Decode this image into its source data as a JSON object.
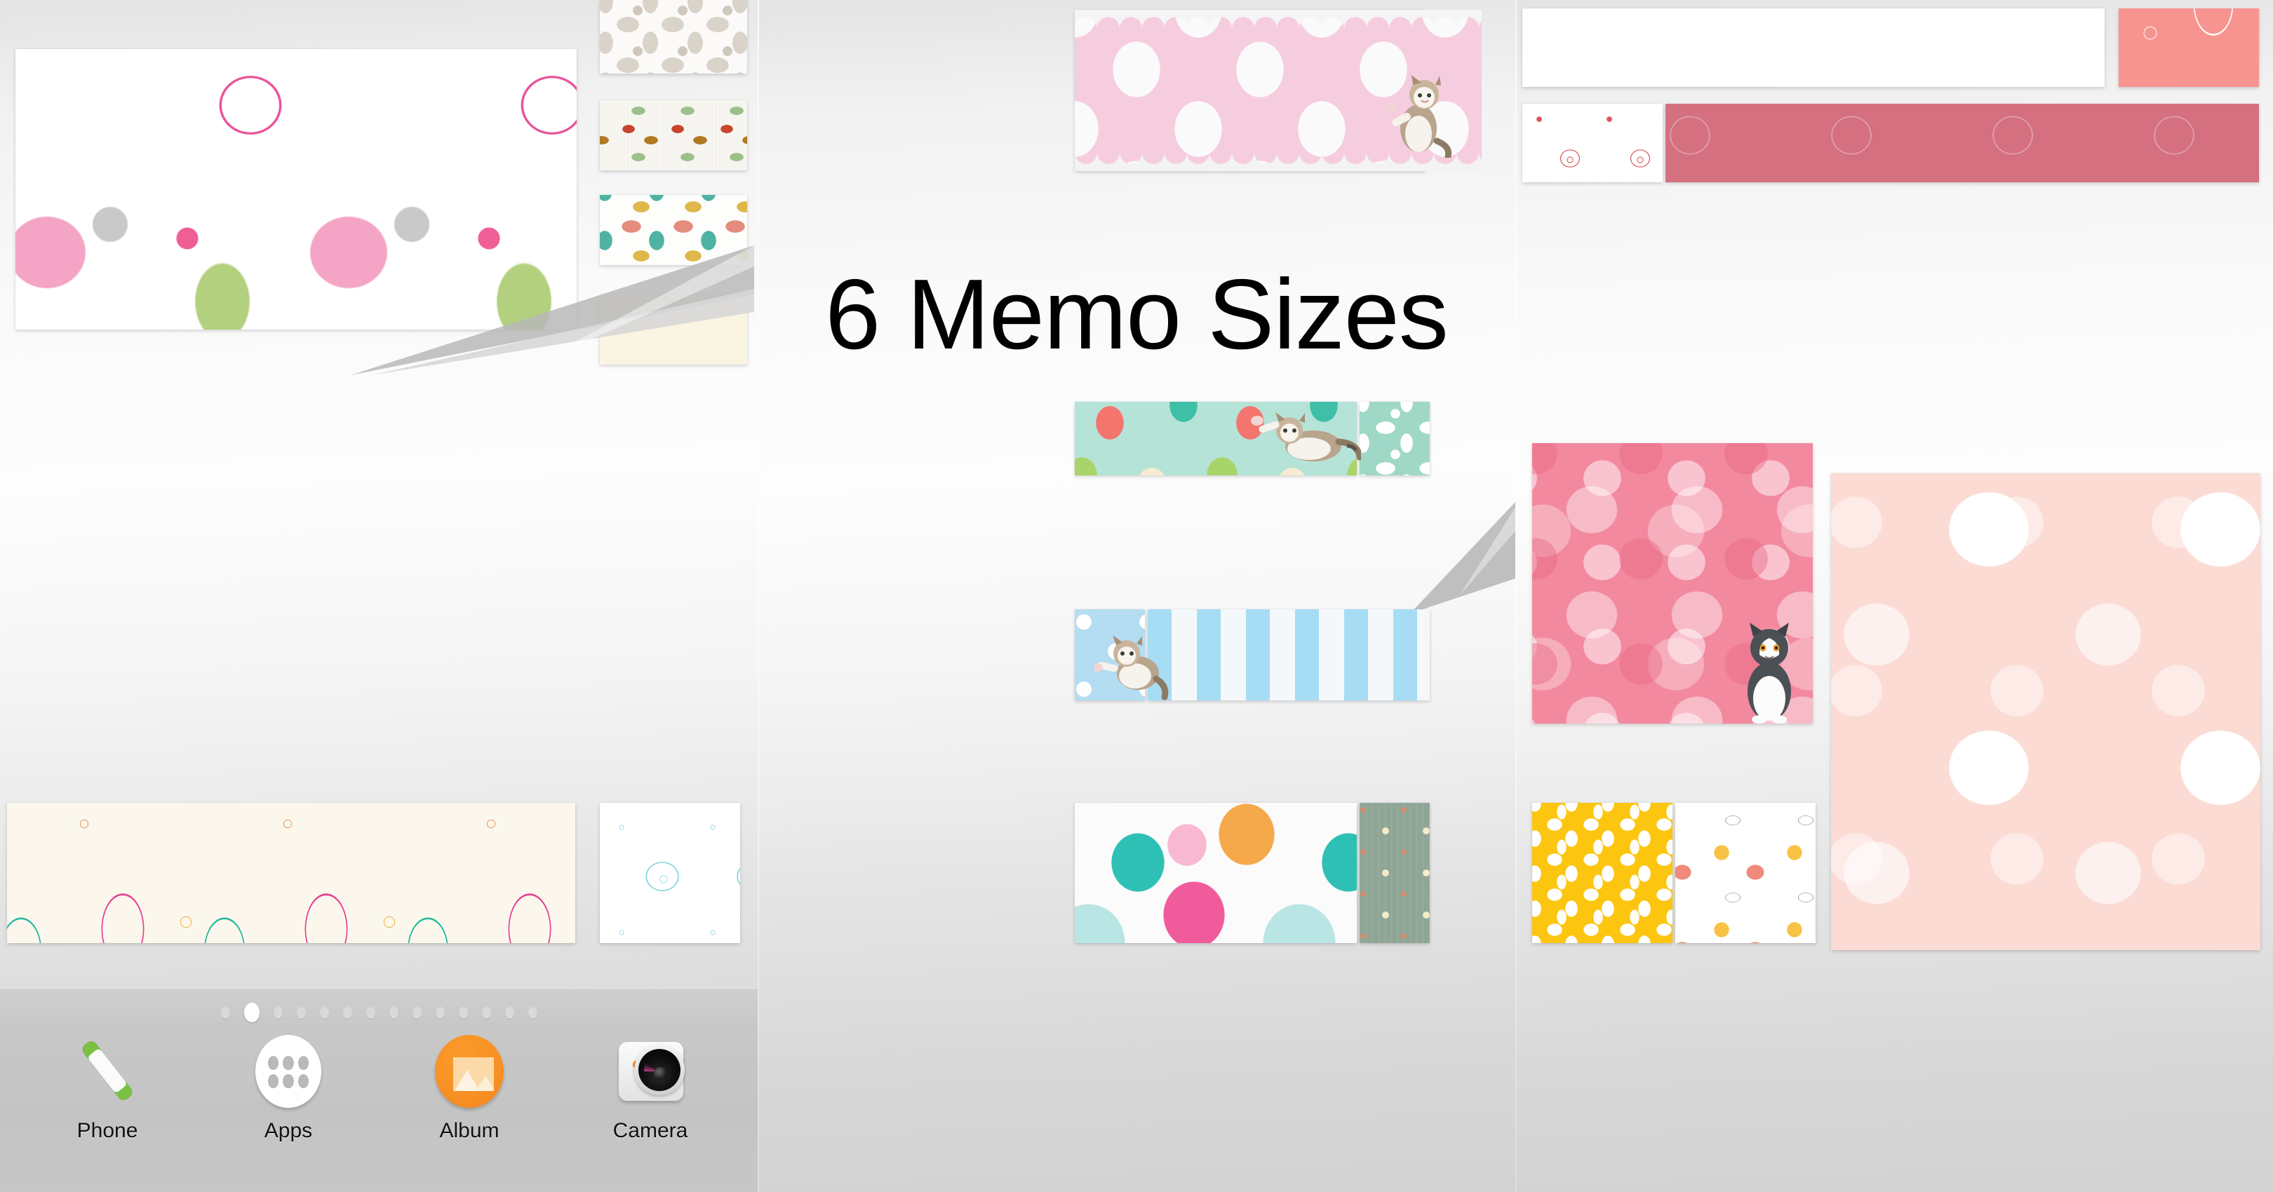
{
  "headline": "6 Memo Sizes",
  "background": {
    "top_color": "#e9e9e9",
    "mid_color": "#fdfdfd",
    "bottom_color": "#cfcfcf"
  },
  "panels": [
    {
      "name": "home-panel-left",
      "memos": [
        {
          "name": "memo-floral-large",
          "pattern": "flower-field",
          "size_label": "large",
          "has_cat": false
        },
        {
          "name": "memo-floral-grey",
          "pattern": "floral-grey",
          "size_label": "small",
          "has_cat": false
        },
        {
          "name": "memo-berry-sprig",
          "pattern": "berry",
          "size_label": "small",
          "has_cat": false
        },
        {
          "name": "memo-linework",
          "pattern": "linework",
          "size_label": "small",
          "has_cat": false
        },
        {
          "name": "memo-cream-flower",
          "pattern": "cream-flower",
          "size_label": "small",
          "has_cat": false
        },
        {
          "name": "memo-paisley-wide",
          "pattern": "paisley",
          "size_label": "wide",
          "has_cat": false
        },
        {
          "name": "memo-blue-outline",
          "pattern": "blue-outline",
          "size_label": "small",
          "has_cat": false
        }
      ]
    },
    {
      "name": "home-panel-center",
      "memos": [
        {
          "name": "memo-pink-polka",
          "pattern": "dots-pink",
          "size_label": "xlarge",
          "has_cat": true
        },
        {
          "name": "memo-mint-polka",
          "pattern": "dots-mint",
          "size_label": "wide",
          "has_cat": true
        },
        {
          "name": "memo-mint-damask",
          "pattern": "mint-damask",
          "size_label": "small",
          "has_cat": false
        },
        {
          "name": "memo-blue-dots",
          "pattern": "blue-dots",
          "size_label": "small",
          "has_cat": true
        },
        {
          "name": "memo-blue-stripes",
          "pattern": "stripes-blue",
          "size_label": "wide",
          "has_cat": false
        },
        {
          "name": "memo-big-dots",
          "pattern": "dots-big",
          "size_label": "wide",
          "has_cat": false
        },
        {
          "name": "memo-sage-grid",
          "pattern": "sage",
          "size_label": "small",
          "has_cat": false
        }
      ]
    },
    {
      "name": "home-panel-right",
      "memos": [
        {
          "name": "memo-peony-band",
          "pattern": "peony",
          "size_label": "wide",
          "has_cat": false
        },
        {
          "name": "memo-coral-paisley",
          "pattern": "coral-paisley",
          "size_label": "small",
          "has_cat": false
        },
        {
          "name": "memo-red-doodle",
          "pattern": "red-doodle",
          "size_label": "small",
          "has_cat": false
        },
        {
          "name": "memo-sakura-band",
          "pattern": "sakura-band",
          "size_label": "wide",
          "has_cat": false
        },
        {
          "name": "memo-sakura-dense",
          "pattern": "sakura-dense",
          "size_label": "medium",
          "has_cat": true
        },
        {
          "name": "memo-sakura-light",
          "pattern": "sakura-light",
          "size_label": "tall",
          "has_cat": false
        },
        {
          "name": "memo-yellow-daisy",
          "pattern": "yellow-daisy",
          "size_label": "small",
          "has_cat": false
        },
        {
          "name": "memo-bird-heart",
          "pattern": "bird",
          "size_label": "small",
          "has_cat": false
        }
      ]
    }
  ],
  "page_indicator": {
    "total": 14,
    "active_index": 1
  },
  "dock": {
    "items": [
      {
        "label": "Phone",
        "icon": "phone-handset-icon",
        "accent": "#7ac143"
      },
      {
        "label": "Apps",
        "icon": "apps-grid-icon",
        "accent": "#ffffff"
      },
      {
        "label": "Album",
        "icon": "album-photo-icon",
        "accent": "#f5871f"
      },
      {
        "label": "Camera",
        "icon": "camera-lens-icon",
        "accent": "#f2821c"
      }
    ]
  }
}
